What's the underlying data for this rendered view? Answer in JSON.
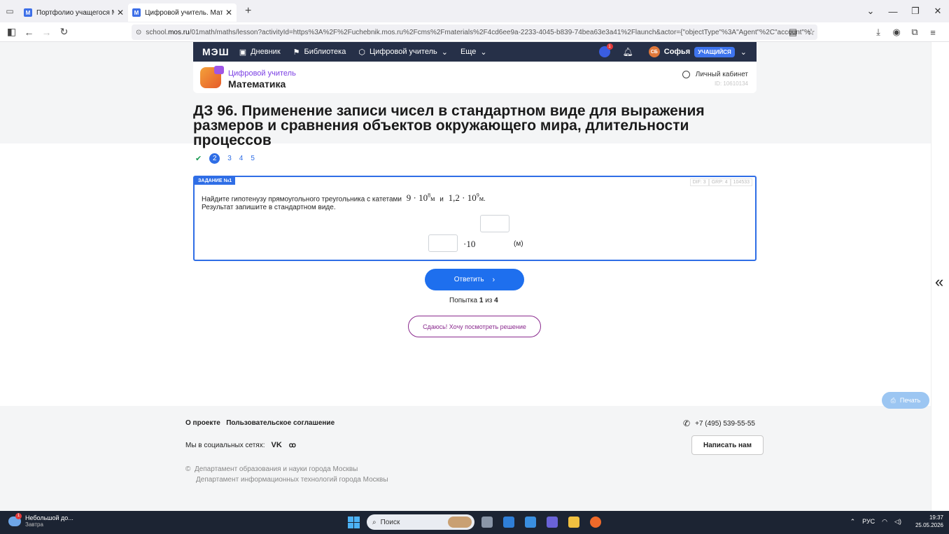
{
  "browser": {
    "tabs": [
      {
        "label": "Портфолио учащегося Москов",
        "active": false
      },
      {
        "label": "Цифровой учитель. Математи",
        "active": true
      }
    ],
    "url_prefix": "school.",
    "url_domain": "mos.ru",
    "url_rest": "/01math/maths/lesson?activityId=https%3A%2F%2Fuchebnik.mos.ru%2Fcms%2Fmaterials%2F4cd6ee9a-2233-4045-b839-74bea63e3a41%2Flaunch&actor={\"objectType\"%3A\"Agent\"%2C\"account\"%"
  },
  "nav": {
    "logo": "МЭШ",
    "items": [
      "Дневник",
      "Библиотека",
      "Цифровой учитель",
      "Еще"
    ],
    "notif_count": "1",
    "avatar_initials": "СБ",
    "user_name": "Софья",
    "role": "УЧАЩИЙСЯ"
  },
  "header": {
    "brand_line1": "Цифровой учитель",
    "brand_line2": "Математика",
    "cabinet": "Личный кабинет",
    "cabinet_id": "ID: 10610134"
  },
  "page_title": "ДЗ 96. Применение записи чисел в стандартном виде для выражения размеров и сравнения объектов окружающего мира, длительности процессов",
  "steps": {
    "done_icon": "check",
    "current": "2",
    "others": [
      "3",
      "4",
      "5"
    ]
  },
  "task": {
    "tag": "ЗАДАНИЕ №1",
    "meta": [
      "DIF: 3",
      "GRP: 4",
      "104533"
    ],
    "question_text": "Найдите гипотенузу прямоугольного  треугольника с катетами",
    "leg1_base": "9 · 10",
    "leg1_exp": "8",
    "unit_m": "м",
    "conj": "и",
    "leg2_base": "1,2 · 10",
    "leg2_exp": "9",
    "unit_m2": "м.",
    "instruction": "Результат запишите в стандартном виде.",
    "times_ten": "·10",
    "unit_label": "(м)",
    "mantissa_value": "",
    "exponent_value": ""
  },
  "answer_button": "Ответить",
  "attempt": {
    "prefix": "Попытка",
    "current": "1",
    "sep": "из",
    "total": "4"
  },
  "giveup_button": "Сдаюсь! Хочу посмотреть решение",
  "footer": {
    "about": "О проекте",
    "agreement": "Пользовательское соглашение",
    "social_label": "Мы в социальных сетях:",
    "phone": "+7 (495) 539-55-55",
    "write_us": "Написать нам",
    "dept1": "Департамент образования и науки города Москвы",
    "dept2": "Департамент информационных технологий города Москвы",
    "print": "Печать"
  },
  "taskbar": {
    "weather_title": "Небольшой до...",
    "weather_sub": "Завтра",
    "weather_badge": "1",
    "search": "Поиск",
    "lang": "РУС",
    "time": "19:37",
    "date": "25.05.2026"
  },
  "colors": {
    "accent": "#2f6ee6",
    "nav_bg": "#263048",
    "giveup": "#8a2a8e"
  }
}
